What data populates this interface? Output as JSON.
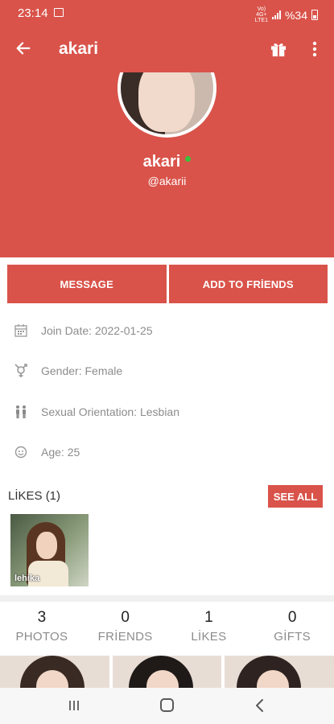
{
  "status_bar": {
    "time": "23:14",
    "network": [
      "Vo)",
      "4G+",
      "LTE1"
    ],
    "battery": "%34",
    "image_icon": "image-notification-icon",
    "color": "#d9534a"
  },
  "app_bar": {
    "back_icon": "arrow-left-icon",
    "title": "akari",
    "gift_icon": "gift-icon",
    "more_icon": "more-vertical-icon"
  },
  "profile": {
    "name": "akari",
    "online": true,
    "online_color": "#38c13c",
    "handle": "@akarii"
  },
  "actions": {
    "message": "MESSAGE",
    "add_friend": "ADD TO FRİENDS"
  },
  "info": {
    "join_date": "Join Date: 2022-01-25",
    "gender": "Gender: Female",
    "orientation": "Sexual Orientation: Lesbian",
    "age": "Age: 25"
  },
  "likes": {
    "label": "LİKES (1)",
    "see_all": "SEE ALL",
    "items": [
      {
        "name": "lehika"
      }
    ]
  },
  "stats": [
    {
      "value": "3",
      "label": "PHOTOS"
    },
    {
      "value": "0",
      "label": "FRİENDS"
    },
    {
      "value": "1",
      "label": "LİKES"
    },
    {
      "value": "0",
      "label": "GİFTS"
    }
  ],
  "accent_color": "#d9534a",
  "nav": {
    "recent_icon": "recent-apps-icon",
    "home_icon": "home-icon",
    "back_icon": "nav-back-icon"
  }
}
